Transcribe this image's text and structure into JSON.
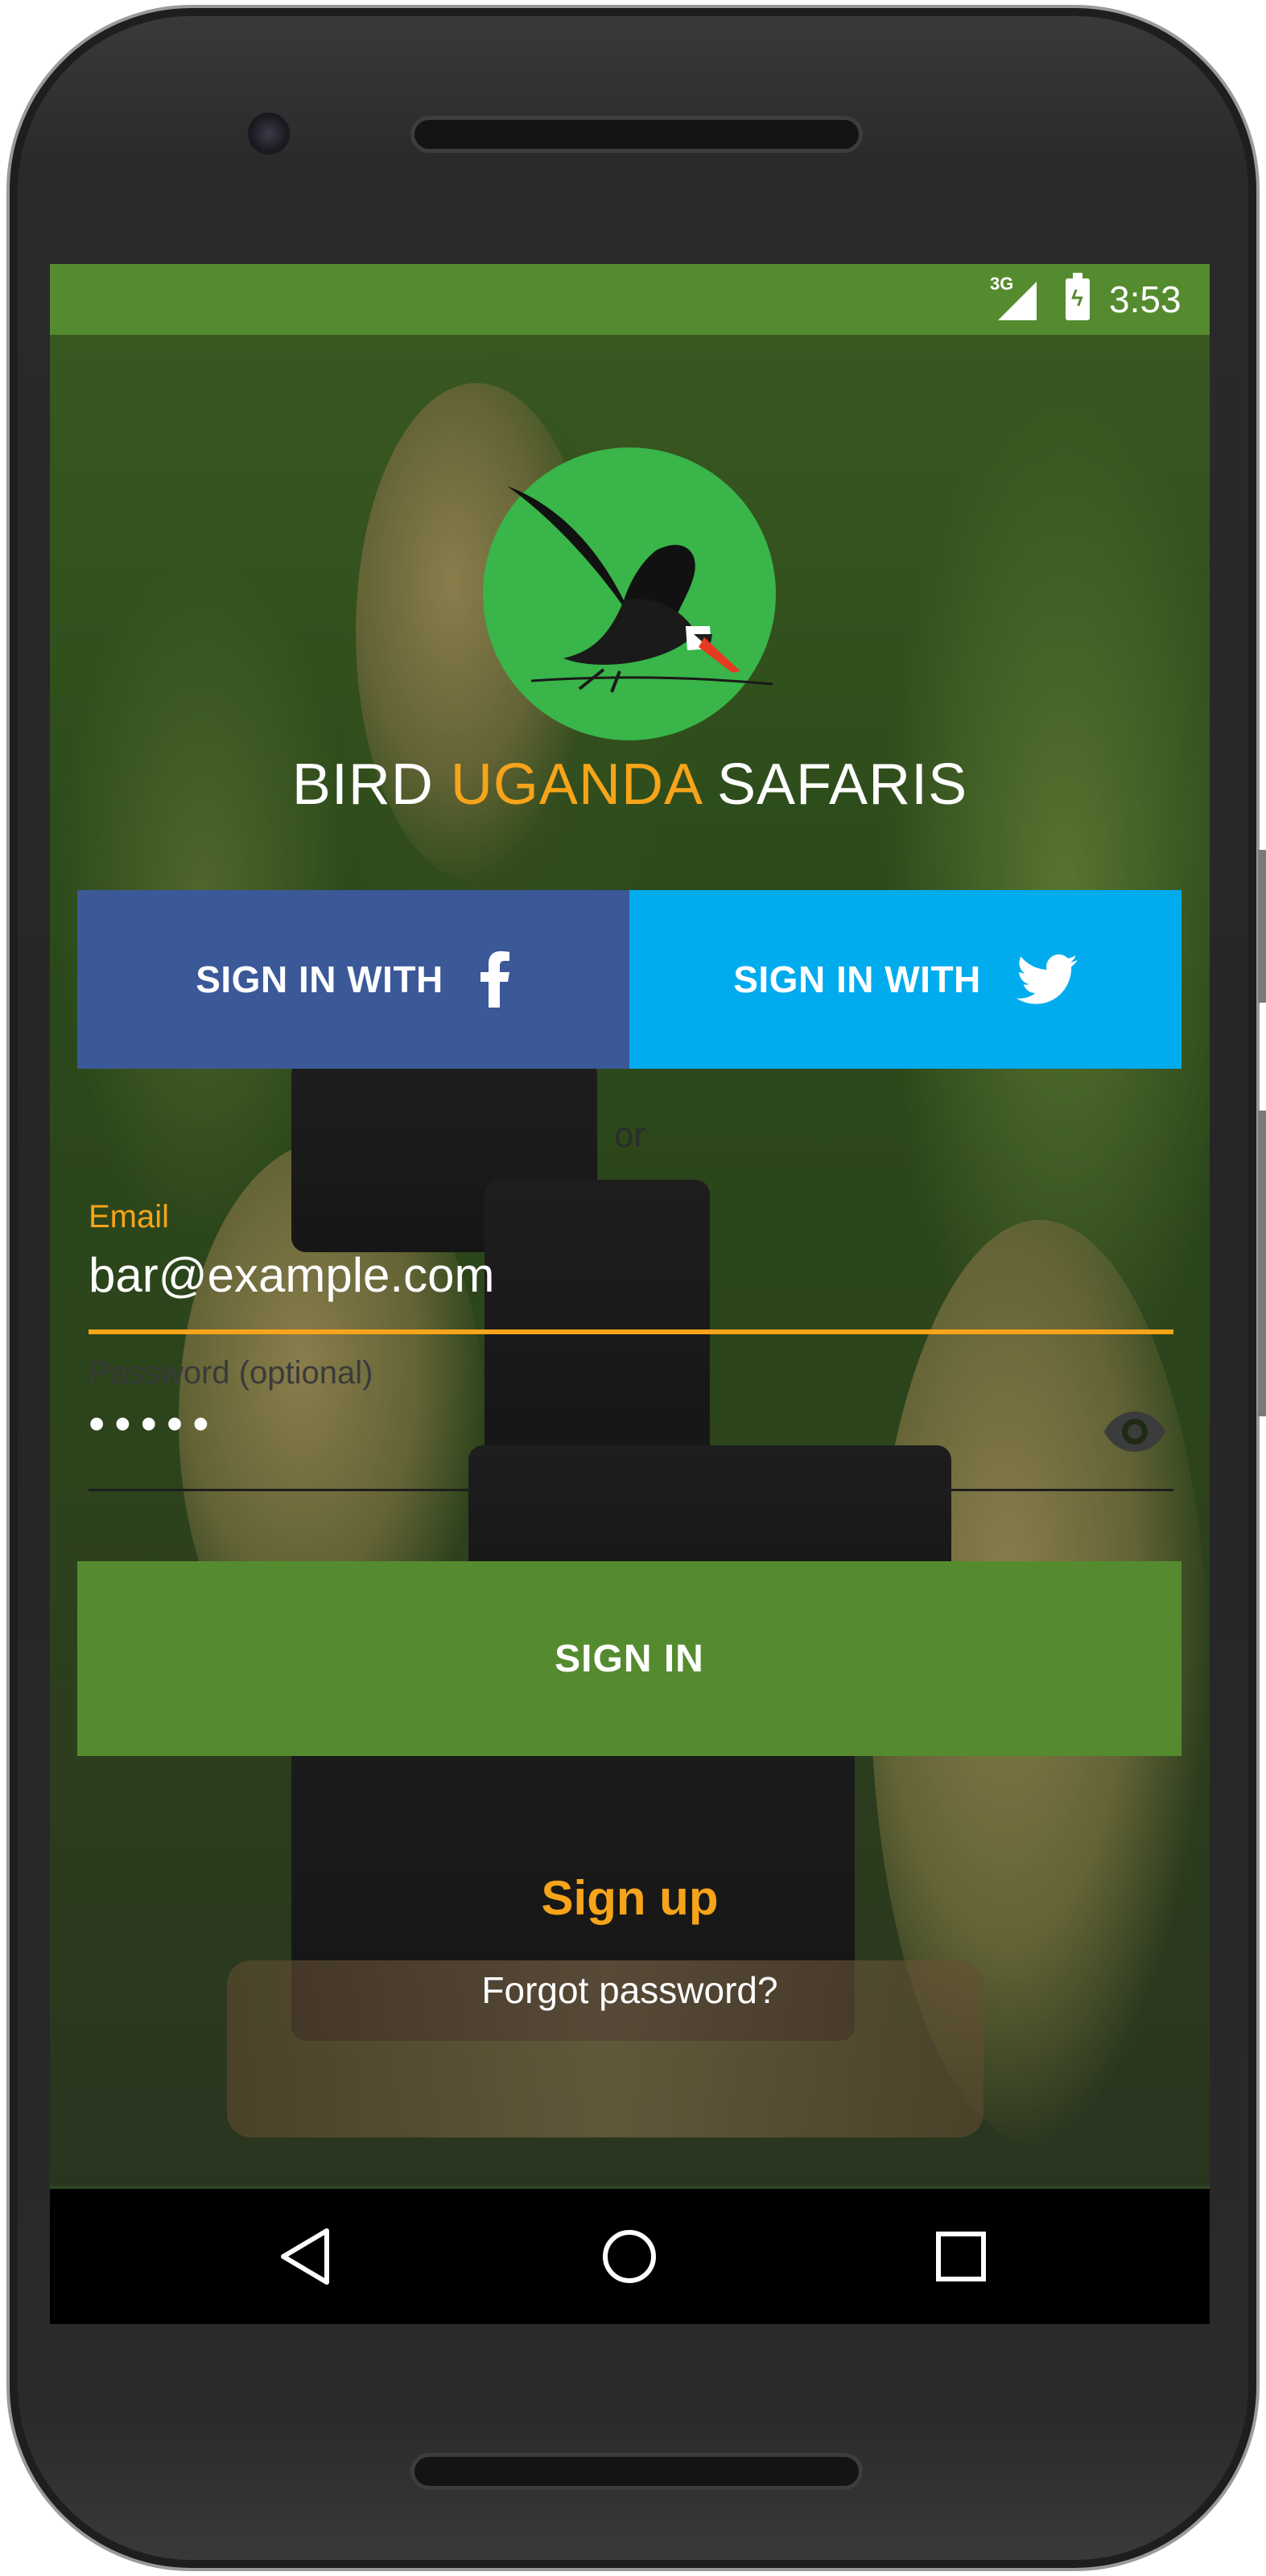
{
  "status_bar": {
    "network": "3G",
    "time": "3:53"
  },
  "brand": {
    "part1": "BIRD ",
    "part2": "UGANDA",
    "part3": " SAFARIS"
  },
  "social": {
    "facebook_label": "SIGN IN WITH",
    "twitter_label": "SIGN IN WITH"
  },
  "divider_text": "or",
  "form": {
    "email_label": "Email",
    "email_value": "bar@example.com",
    "password_label": "Password (optional)",
    "password_mask": "•••••"
  },
  "actions": {
    "sign_in_label": "SIGN IN",
    "sign_up_label": "Sign up",
    "forgot_label": "Forgot password?"
  },
  "colors": {
    "primary_green": "#558b2f",
    "accent_orange": "#f7a41a",
    "facebook_blue": "#3b5998",
    "twitter_blue": "#00acee",
    "logo_green": "#39b54a"
  },
  "icons": {
    "facebook": "facebook-icon",
    "twitter": "twitter-icon",
    "eye": "eye-icon",
    "back": "back-icon",
    "home": "home-icon",
    "recents": "recents-icon"
  }
}
